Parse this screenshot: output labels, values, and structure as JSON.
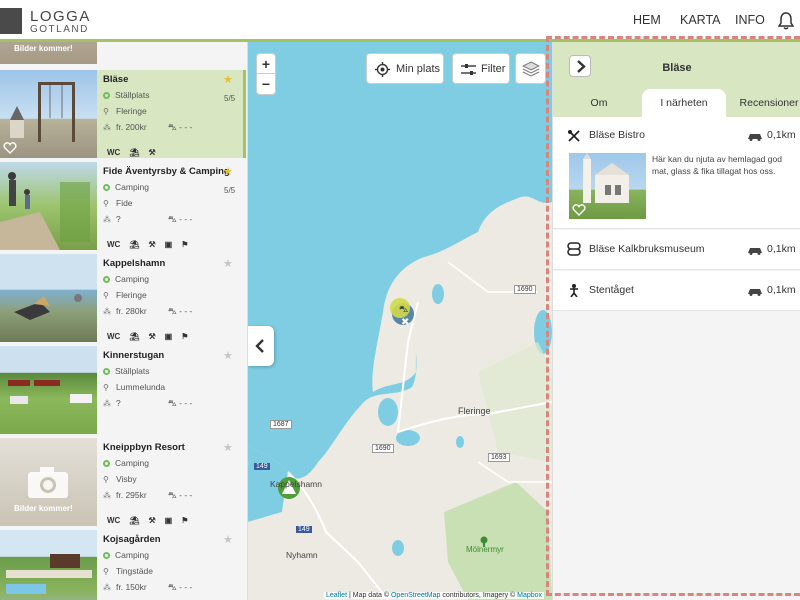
{
  "header": {
    "logo_line1": "LOGGA",
    "logo_line2": "GOTLAND",
    "nav": [
      "HEM",
      "KARTA",
      "INFO"
    ]
  },
  "top_card": {
    "label": "Bilder kommer!"
  },
  "cards": [
    {
      "name": "Bläse",
      "type": "Ställplats",
      "location": "Fleringe",
      "price": "fr. 200kr",
      "distance": "- - -",
      "rating": "5/5",
      "starred": true,
      "amenities": [
        "WC",
        "shower",
        "tap"
      ]
    },
    {
      "name": "Fide Äventyrsby & Camping",
      "type": "Camping",
      "location": "Fide",
      "price": "?",
      "distance": "- - -",
      "rating": "5/5",
      "starred": true,
      "amenities": [
        "WC",
        "shower",
        "tap",
        "electricity",
        "dump"
      ]
    },
    {
      "name": "Kappelshamn",
      "type": "Camping",
      "location": "Fleringe",
      "price": "fr. 280kr",
      "distance": "- - -",
      "rating": "",
      "starred": false,
      "amenities": [
        "WC",
        "shower",
        "tap",
        "electricity",
        "dump"
      ]
    },
    {
      "name": "Kinnerstugan",
      "type": "Ställplats",
      "location": "Lummelunda",
      "price": "?",
      "distance": "- - -",
      "rating": "",
      "starred": false,
      "amenities": []
    },
    {
      "name": "Kneippbyn Resort",
      "type": "Camping",
      "location": "Visby",
      "price": "fr. 295kr",
      "distance": "- - -",
      "rating": "",
      "starred": false,
      "amenities": [
        "WC",
        "shower",
        "tap",
        "electricity",
        "dump"
      ],
      "placeholder": "Bilder kommer!"
    },
    {
      "name": "Kojsagården",
      "type": "Camping",
      "location": "Tingstäde",
      "price": "fr. 150kr",
      "distance": "- - -",
      "rating": "",
      "starred": false,
      "amenities": []
    }
  ],
  "map": {
    "my_location": "Min plats",
    "filter": "Filter",
    "zoom_in": "+",
    "zoom_out": "−",
    "labels": {
      "fleringe": "Fleringe",
      "kappelshamn": "Kappelshamn",
      "nyhamn": "Nyhamn",
      "molnermyr": "Mölnermyr"
    },
    "roads": [
      "1690",
      "1690",
      "1693",
      "1687",
      "149",
      "149"
    ],
    "attribution_leaflet": "Leaflet",
    "attribution_sep": " | Map data © ",
    "attribution_osm": "OpenStreetMap",
    "attribution_mid": " contributors, Imagery © ",
    "attribution_mapbox": "Mapbox"
  },
  "panel": {
    "title": "Bläse",
    "tabs": [
      "Om",
      "I närheten",
      "Recensioner"
    ],
    "active_tab": "I närheten",
    "nearby": [
      {
        "name": "Bläse Bistro",
        "distance": "0,1km",
        "icon": "restaurant-icon",
        "description": "Här kan du njuta av hemlagad god mat, glass & fika tillagat hos oss."
      },
      {
        "name": "Bläse Kalkbruksmuseum",
        "distance": "0,1km",
        "icon": "museum-icon"
      },
      {
        "name": "Stentåget",
        "distance": "0,1km",
        "icon": "attraction-icon"
      }
    ]
  },
  "colors": {
    "accent": "#a4c163",
    "selected_bg": "#d8e7c2",
    "water": "#7fcde3",
    "land": "#edeae4",
    "highlight_dash": "#d9857c"
  }
}
